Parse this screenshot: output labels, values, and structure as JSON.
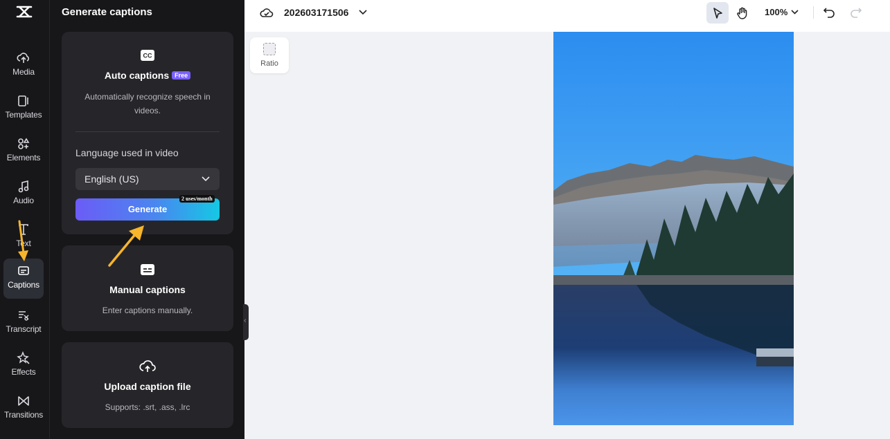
{
  "rail": {
    "items": [
      {
        "label": "Media",
        "icon": "media-icon"
      },
      {
        "label": "Templates",
        "icon": "templates-icon"
      },
      {
        "label": "Elements",
        "icon": "elements-icon"
      },
      {
        "label": "Audio",
        "icon": "audio-icon"
      },
      {
        "label": "Text",
        "icon": "text-icon"
      },
      {
        "label": "Captions",
        "icon": "captions-icon",
        "active": true
      },
      {
        "label": "Transcript",
        "icon": "transcript-icon"
      },
      {
        "label": "Effects",
        "icon": "effects-icon"
      },
      {
        "label": "Transitions",
        "icon": "transitions-icon"
      }
    ]
  },
  "panel": {
    "title": "Generate captions",
    "auto": {
      "title": "Auto captions",
      "badge": "Free",
      "description": "Automatically recognize speech in videos.",
      "language_label": "Language used in video",
      "language_value": "English (US)",
      "generate_label": "Generate",
      "uses_badge": "2 uses/month"
    },
    "manual": {
      "title": "Manual captions",
      "description": "Enter captions manually."
    },
    "upload": {
      "title": "Upload caption file",
      "description": "Supports: .srt, .ass, .lrc"
    }
  },
  "topbar": {
    "project_name": "202603171506",
    "zoom": "100%"
  },
  "canvas": {
    "ratio_label": "Ratio"
  },
  "colors": {
    "accent_arrow": "#f7b52c",
    "free_badge": "#7b61ff"
  }
}
